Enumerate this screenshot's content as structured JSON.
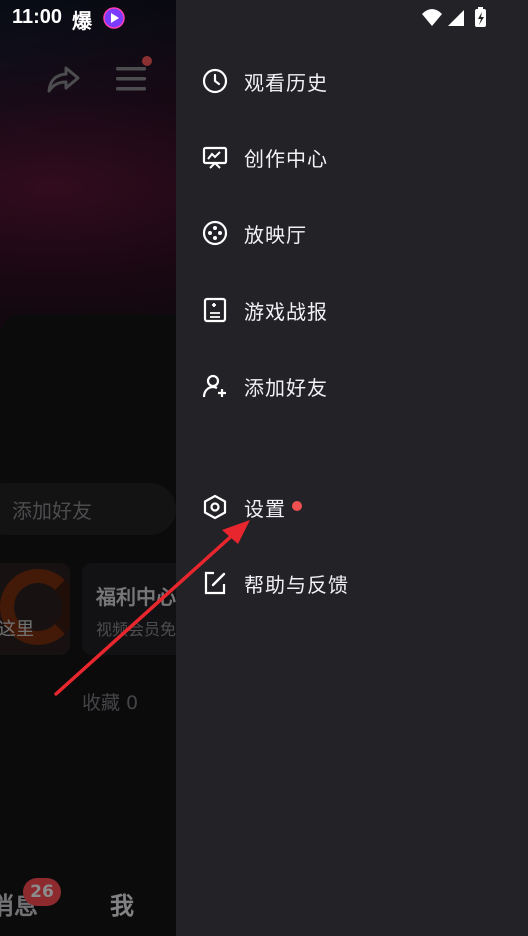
{
  "status_bar": {
    "time": "11:00",
    "notification_char": "爆"
  },
  "background": {
    "add_friend_label": "添加好友",
    "promo_left_text": "这里",
    "promo_right_title": "福利中心",
    "promo_right_subtitle": "视频会员免",
    "favorites_label": "收藏 0",
    "tabs": [
      {
        "label": "消息",
        "badge": "26"
      },
      {
        "label": "我"
      }
    ]
  },
  "drawer": {
    "items": [
      {
        "label": "观看历史",
        "icon": "clock-icon"
      },
      {
        "label": "创作中心",
        "icon": "creator-monitor-icon"
      },
      {
        "label": "放映厅",
        "icon": "film-reel-icon"
      },
      {
        "label": "游戏战报",
        "icon": "game-report-icon"
      },
      {
        "label": "添加好友",
        "icon": "add-person-icon"
      },
      {
        "label": "设置",
        "icon": "settings-hexagon-icon",
        "has_dot": true
      },
      {
        "label": "帮助与反馈",
        "icon": "edit-feedback-icon"
      }
    ]
  },
  "colors": {
    "drawer_bg": "#222227",
    "badge": "#ff4d55",
    "annotation_arrow": "#e8262e"
  }
}
